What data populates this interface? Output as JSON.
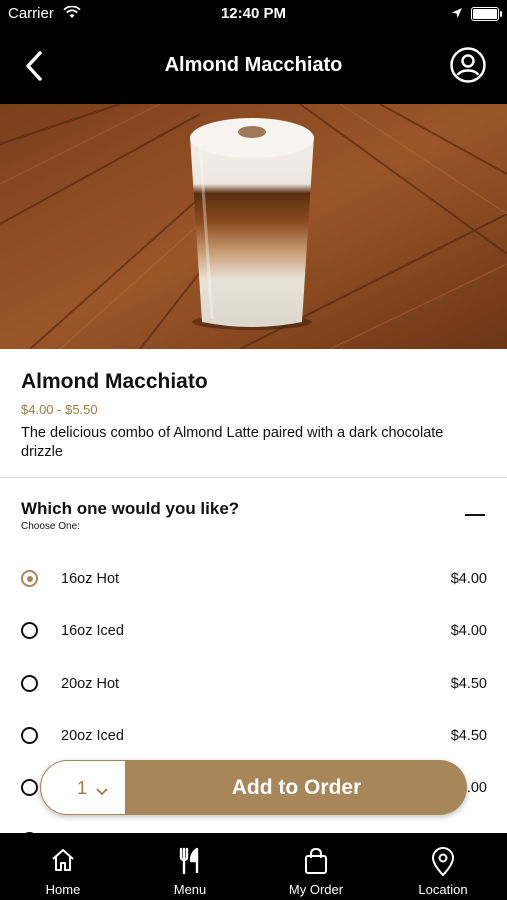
{
  "status": {
    "carrier": "Carrier",
    "time": "12:40 PM"
  },
  "nav": {
    "title": "Almond Macchiato"
  },
  "product": {
    "name": "Almond Macchiato",
    "price_range": "$4.00 - $5.50",
    "description": "The delicious combo of Almond Latte paired with a dark chocolate drizzle"
  },
  "options_group": {
    "question": "Which one would you like?",
    "hint": "Choose One:",
    "options": [
      {
        "label": "16oz Hot",
        "price": "$4.00",
        "selected": true
      },
      {
        "label": "16oz Iced",
        "price": "$4.00",
        "selected": false
      },
      {
        "label": "20oz Hot",
        "price": "$4.50",
        "selected": false
      },
      {
        "label": "20oz Iced",
        "price": "$4.50",
        "selected": false
      },
      {
        "label": "",
        "price": "$5.00",
        "selected": false
      }
    ]
  },
  "cart": {
    "quantity": "1",
    "add_label": "Add to Order"
  },
  "tabs": [
    {
      "label": "Home",
      "icon": "home-icon"
    },
    {
      "label": "Menu",
      "icon": "fork-knife-icon"
    },
    {
      "label": "My Order",
      "icon": "bag-icon"
    },
    {
      "label": "Location",
      "icon": "location-pin-icon"
    }
  ],
  "colors": {
    "accent": "#a7875a",
    "bar": "#000000"
  }
}
